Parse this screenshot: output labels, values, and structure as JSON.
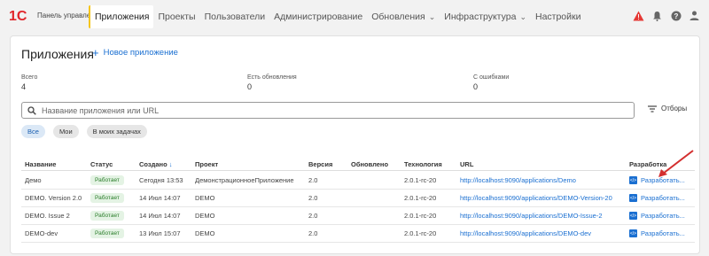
{
  "header": {
    "logo_text": "1С",
    "app_title": "Панель управления",
    "nav": [
      {
        "label": "Приложения",
        "active": true,
        "dropdown": false
      },
      {
        "label": "Проекты",
        "active": false,
        "dropdown": false
      },
      {
        "label": "Пользователи",
        "active": false,
        "dropdown": false
      },
      {
        "label": "Администрирование",
        "active": false,
        "dropdown": false
      },
      {
        "label": "Обновления",
        "active": false,
        "dropdown": true
      },
      {
        "label": "Инфраструктура",
        "active": false,
        "dropdown": true
      },
      {
        "label": "Настройки",
        "active": false,
        "dropdown": false
      }
    ],
    "icons": [
      "warning-icon",
      "bell-icon",
      "help-icon",
      "user-icon"
    ],
    "accent_color": "#f5c518",
    "warning_color": "#e53935"
  },
  "page": {
    "title": "Приложения",
    "new_app_label": "Новое приложение",
    "stats": [
      {
        "label": "Всего",
        "value": "4"
      },
      {
        "label": "Есть обновления",
        "value": "0"
      },
      {
        "label": "С ошибками",
        "value": "0"
      }
    ],
    "search_placeholder": "Название приложения или URL",
    "filters_label": "Отборы",
    "chips": [
      {
        "label": "Все",
        "active": true
      },
      {
        "label": "Мои",
        "active": false
      },
      {
        "label": "В моих задачах",
        "active": false
      }
    ]
  },
  "table": {
    "columns": [
      "Название",
      "Статус",
      "Создано",
      "Проект",
      "Версия",
      "Обновлено",
      "Технология",
      "URL",
      "Разработка"
    ],
    "sort_indicator": "↓",
    "rows": [
      {
        "name": "Демо",
        "status": "Работает",
        "created": "Сегодня 13:53",
        "project": "ДемонстрационноеПриложение",
        "version": "2.0",
        "updated": "",
        "tech": "2.0.1-rc-20",
        "url": "http://localhost:9090/applications/Demo",
        "dev": "Разработать..."
      },
      {
        "name": "DEMO. Version 2.0",
        "status": "Работает",
        "created": "14 Июл 14:07",
        "project": "DEMO",
        "version": "2.0",
        "updated": "",
        "tech": "2.0.1-rc-20",
        "url": "http://localhost:9090/applications/DEMO-Version-20",
        "dev": "Разработать..."
      },
      {
        "name": "DEMO. Issue 2",
        "status": "Работает",
        "created": "14 Июл 14:07",
        "project": "DEMO",
        "version": "2.0",
        "updated": "",
        "tech": "2.0.1-rc-20",
        "url": "http://localhost:9090/applications/DEMO-Issue-2",
        "dev": "Разработать..."
      },
      {
        "name": "DEMO-dev",
        "status": "Работает",
        "created": "13 Июл 15:07",
        "project": "DEMO",
        "version": "2.0",
        "updated": "",
        "tech": "2.0.1-rc-20",
        "url": "http://localhost:9090/applications/DEMO-dev",
        "dev": "Разработать..."
      }
    ]
  },
  "colors": {
    "link": "#1a6fd1",
    "status_ok": "#2a7d2a",
    "annotation_arrow": "#d32f2f"
  }
}
